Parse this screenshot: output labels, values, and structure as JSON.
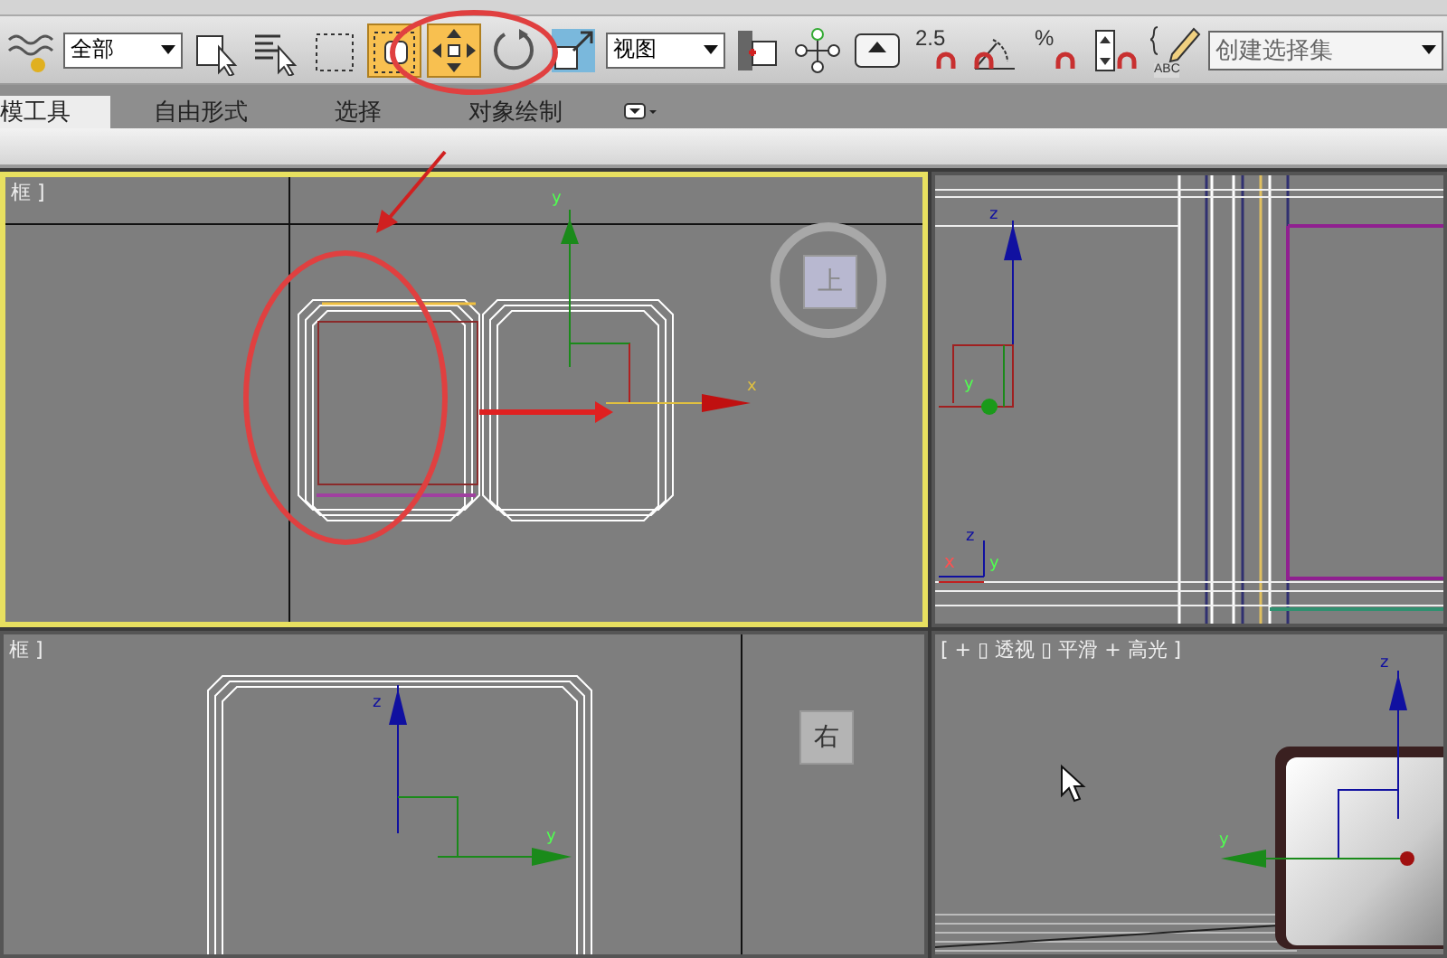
{
  "toolbar": [
    {
      "kind": "waves",
      "selected": false
    },
    {
      "kind": "dropdown",
      "value": "全部"
    },
    {
      "kind": "select",
      "selected": false
    },
    {
      "kind": "select-name",
      "selected": false
    },
    {
      "kind": "rect-region",
      "selected": false
    },
    {
      "kind": "window",
      "selected": true
    },
    {
      "kind": "move",
      "selected": true
    },
    {
      "kind": "rotate",
      "selected": false
    },
    {
      "kind": "scale",
      "selected": false
    },
    {
      "kind": "dropdown",
      "value": "视图"
    },
    {
      "kind": "pivot",
      "selected": false
    },
    {
      "kind": "manipulate",
      "selected": false
    },
    {
      "kind": "keyboard",
      "selected": false
    },
    {
      "kind": "snap",
      "label": "2.5",
      "selected": false
    },
    {
      "kind": "angle-snap",
      "selected": false
    },
    {
      "kind": "percent-snap",
      "label": "%",
      "selected": false
    },
    {
      "kind": "spinner-snap",
      "selected": false
    },
    {
      "kind": "edit-set",
      "label": "ABC",
      "selected": false
    },
    {
      "kind": "combo",
      "value": "创建选择集"
    }
  ],
  "ribbon_tabs": [
    {
      "label": "模工具",
      "selected": true
    },
    {
      "label": "自由形式",
      "selected": false
    },
    {
      "label": "选择",
      "selected": false
    },
    {
      "label": "对象绘制",
      "selected": false
    }
  ],
  "viewports": [
    {
      "kind": "top",
      "label": "框 ]",
      "active": true,
      "axes": [
        "y",
        "x"
      ],
      "viewcube": "上"
    },
    {
      "kind": "front",
      "active": false,
      "axes": [
        "z",
        "y",
        "z",
        "x",
        "y"
      ]
    },
    {
      "kind": "left",
      "label": "框 ]",
      "active": false,
      "axes": [
        "z",
        "y"
      ],
      "viewcube": "右"
    },
    {
      "kind": "perspective",
      "label": "[ + ▯ 透视 ▯ 平滑 + 高光 ]",
      "active": false,
      "axes": [
        "z",
        "y"
      ]
    }
  ]
}
